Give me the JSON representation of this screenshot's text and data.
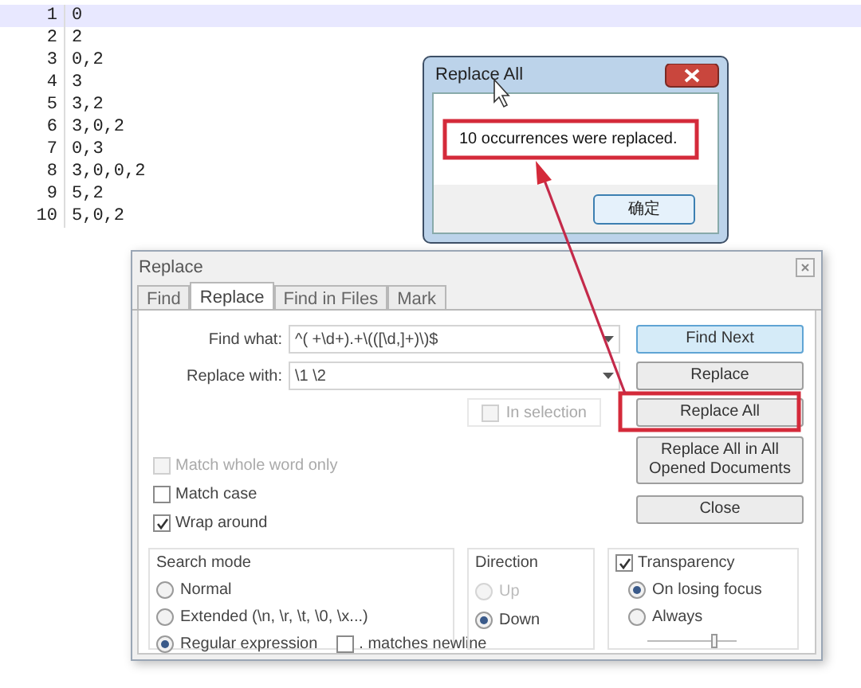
{
  "editor": {
    "lines": [
      {
        "number": "1",
        "text": "0",
        "current": true
      },
      {
        "number": "2",
        "text": "2",
        "current": false
      },
      {
        "number": "3",
        "text": "0,2",
        "current": false
      },
      {
        "number": "4",
        "text": "3",
        "current": false
      },
      {
        "number": "5",
        "text": "3,2",
        "current": false
      },
      {
        "number": "6",
        "text": "3,0,2",
        "current": false
      },
      {
        "number": "7",
        "text": "0,3",
        "current": false
      },
      {
        "number": "8",
        "text": "3,0,0,2",
        "current": false
      },
      {
        "number": "9",
        "text": "5,2",
        "current": false
      },
      {
        "number": "10",
        "text": "5,0,2",
        "current": false
      }
    ]
  },
  "replace_dialog": {
    "title": "Replace",
    "tabs": [
      {
        "label": "Find",
        "selected": false
      },
      {
        "label": "Replace",
        "selected": true
      },
      {
        "label": "Find in Files",
        "selected": false
      },
      {
        "label": "Mark",
        "selected": false
      }
    ],
    "find_what": {
      "label": "Find what:",
      "value": "^( +\\d+).+\\(([\\d,]+)\\)$"
    },
    "replace_with": {
      "label": "Replace with:",
      "value": "\\1 \\2"
    },
    "in_selection": {
      "label": "In selection",
      "checked": false,
      "disabled": true
    },
    "buttons": [
      {
        "label": "Find Next",
        "default": true
      },
      {
        "label": "Replace",
        "default": false
      },
      {
        "label": "Replace All",
        "default": false
      },
      {
        "label": "Replace All in All Opened Documents",
        "default": false
      },
      {
        "label": "Close",
        "default": false
      }
    ],
    "options": [
      {
        "label": "Match whole word only",
        "checked": false,
        "disabled": true
      },
      {
        "label": "Match case",
        "checked": false,
        "disabled": false
      },
      {
        "label": "Wrap around",
        "checked": true,
        "disabled": false
      }
    ],
    "search_mode": {
      "title": "Search mode",
      "options": [
        {
          "label": "Normal",
          "selected": false
        },
        {
          "label": "Extended (\\n, \\r, \\t, \\0, \\x...)",
          "selected": false
        },
        {
          "label": "Regular expression",
          "selected": true
        }
      ],
      "dot_matches_newline": {
        "label": ". matches newline",
        "checked": false
      }
    },
    "direction": {
      "title": "Direction",
      "options": [
        {
          "label": "Up",
          "selected": false,
          "disabled": true
        },
        {
          "label": "Down",
          "selected": true,
          "disabled": false
        }
      ]
    },
    "transparency": {
      "label": "Transparency",
      "checked": true,
      "options": [
        {
          "label": "On losing focus",
          "selected": true
        },
        {
          "label": "Always",
          "selected": false
        }
      ],
      "level": 0.75
    }
  },
  "message_box": {
    "title": "Replace All",
    "message": "10 occurrences were replaced.",
    "button": "确定"
  }
}
